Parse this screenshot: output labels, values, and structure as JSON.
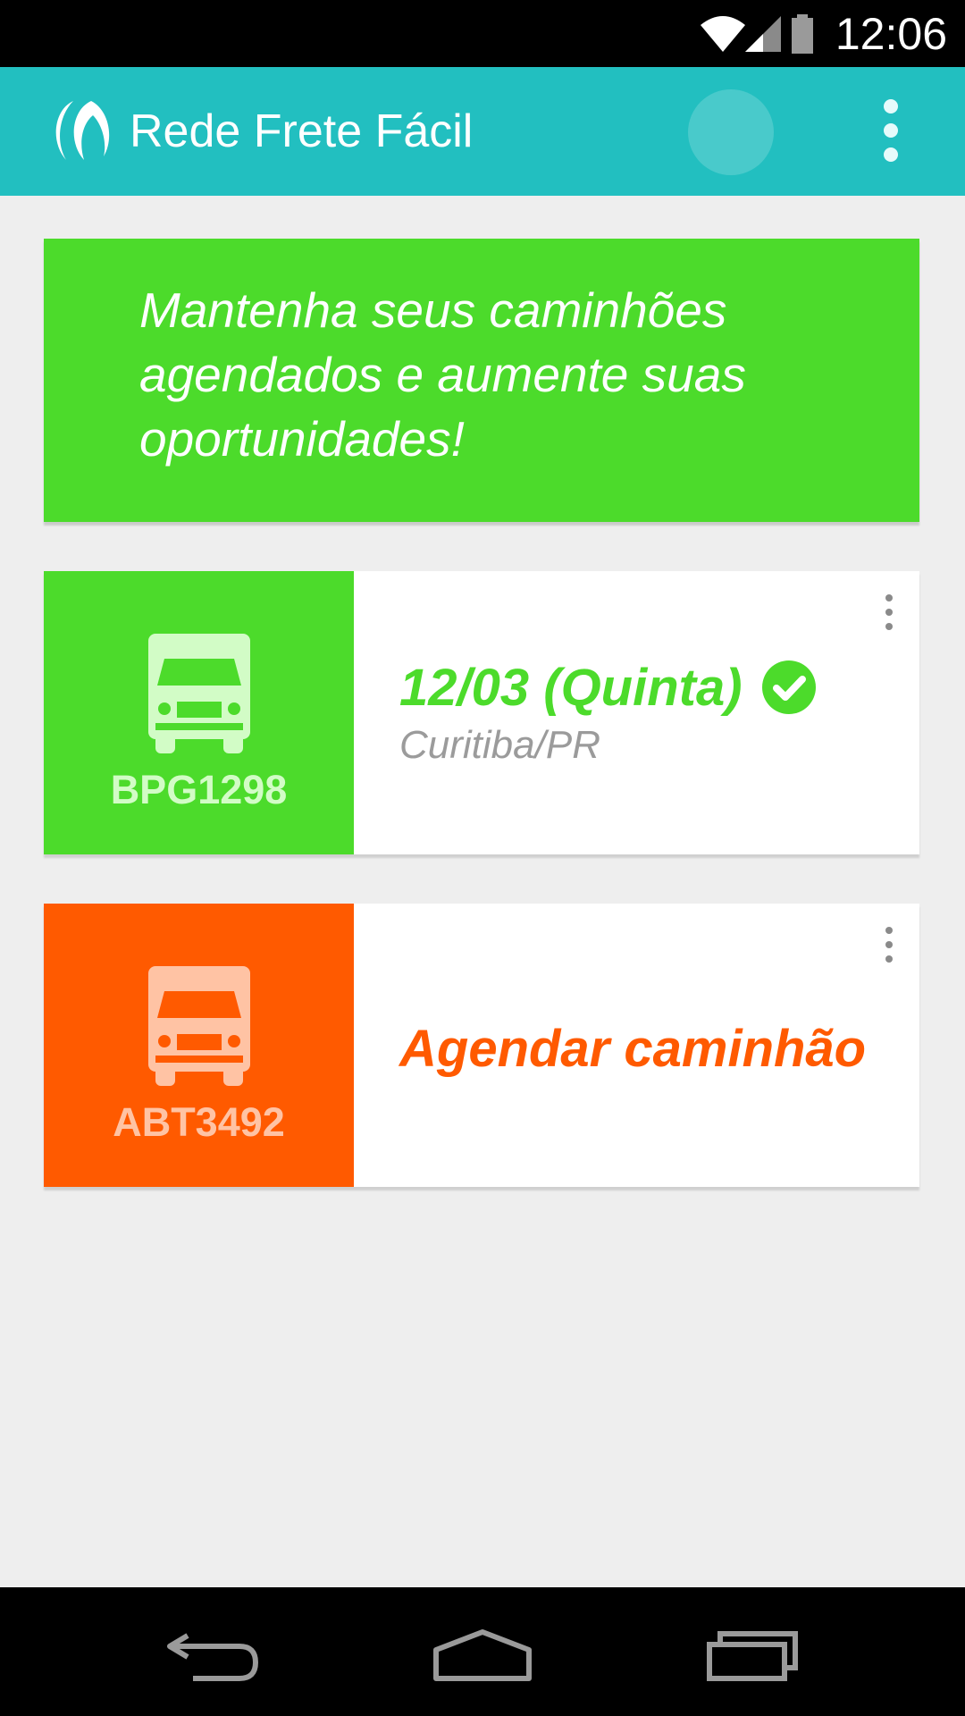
{
  "status_bar": {
    "time": "12:06",
    "icons": [
      "wifi-icon",
      "signal-icon",
      "battery-icon"
    ]
  },
  "app_bar": {
    "title": "Rede Frete Fácil",
    "color": "#22bfc0"
  },
  "banner": {
    "text": "Mantenha seus caminhões agendados e aumente suas oportunidades!",
    "color": "#4cdb2b"
  },
  "trucks": [
    {
      "plate": "BPG1298",
      "status": "scheduled",
      "color": "#4cdb2b",
      "date": "12/03 (Quinta)",
      "city": "Curitiba/PR"
    },
    {
      "plate": "ABT3492",
      "status": "unscheduled",
      "color": "#ff5a00",
      "action": "Agendar caminhão"
    }
  ],
  "nav_bar": {
    "buttons": [
      "back-icon",
      "home-icon",
      "recents-icon"
    ]
  }
}
